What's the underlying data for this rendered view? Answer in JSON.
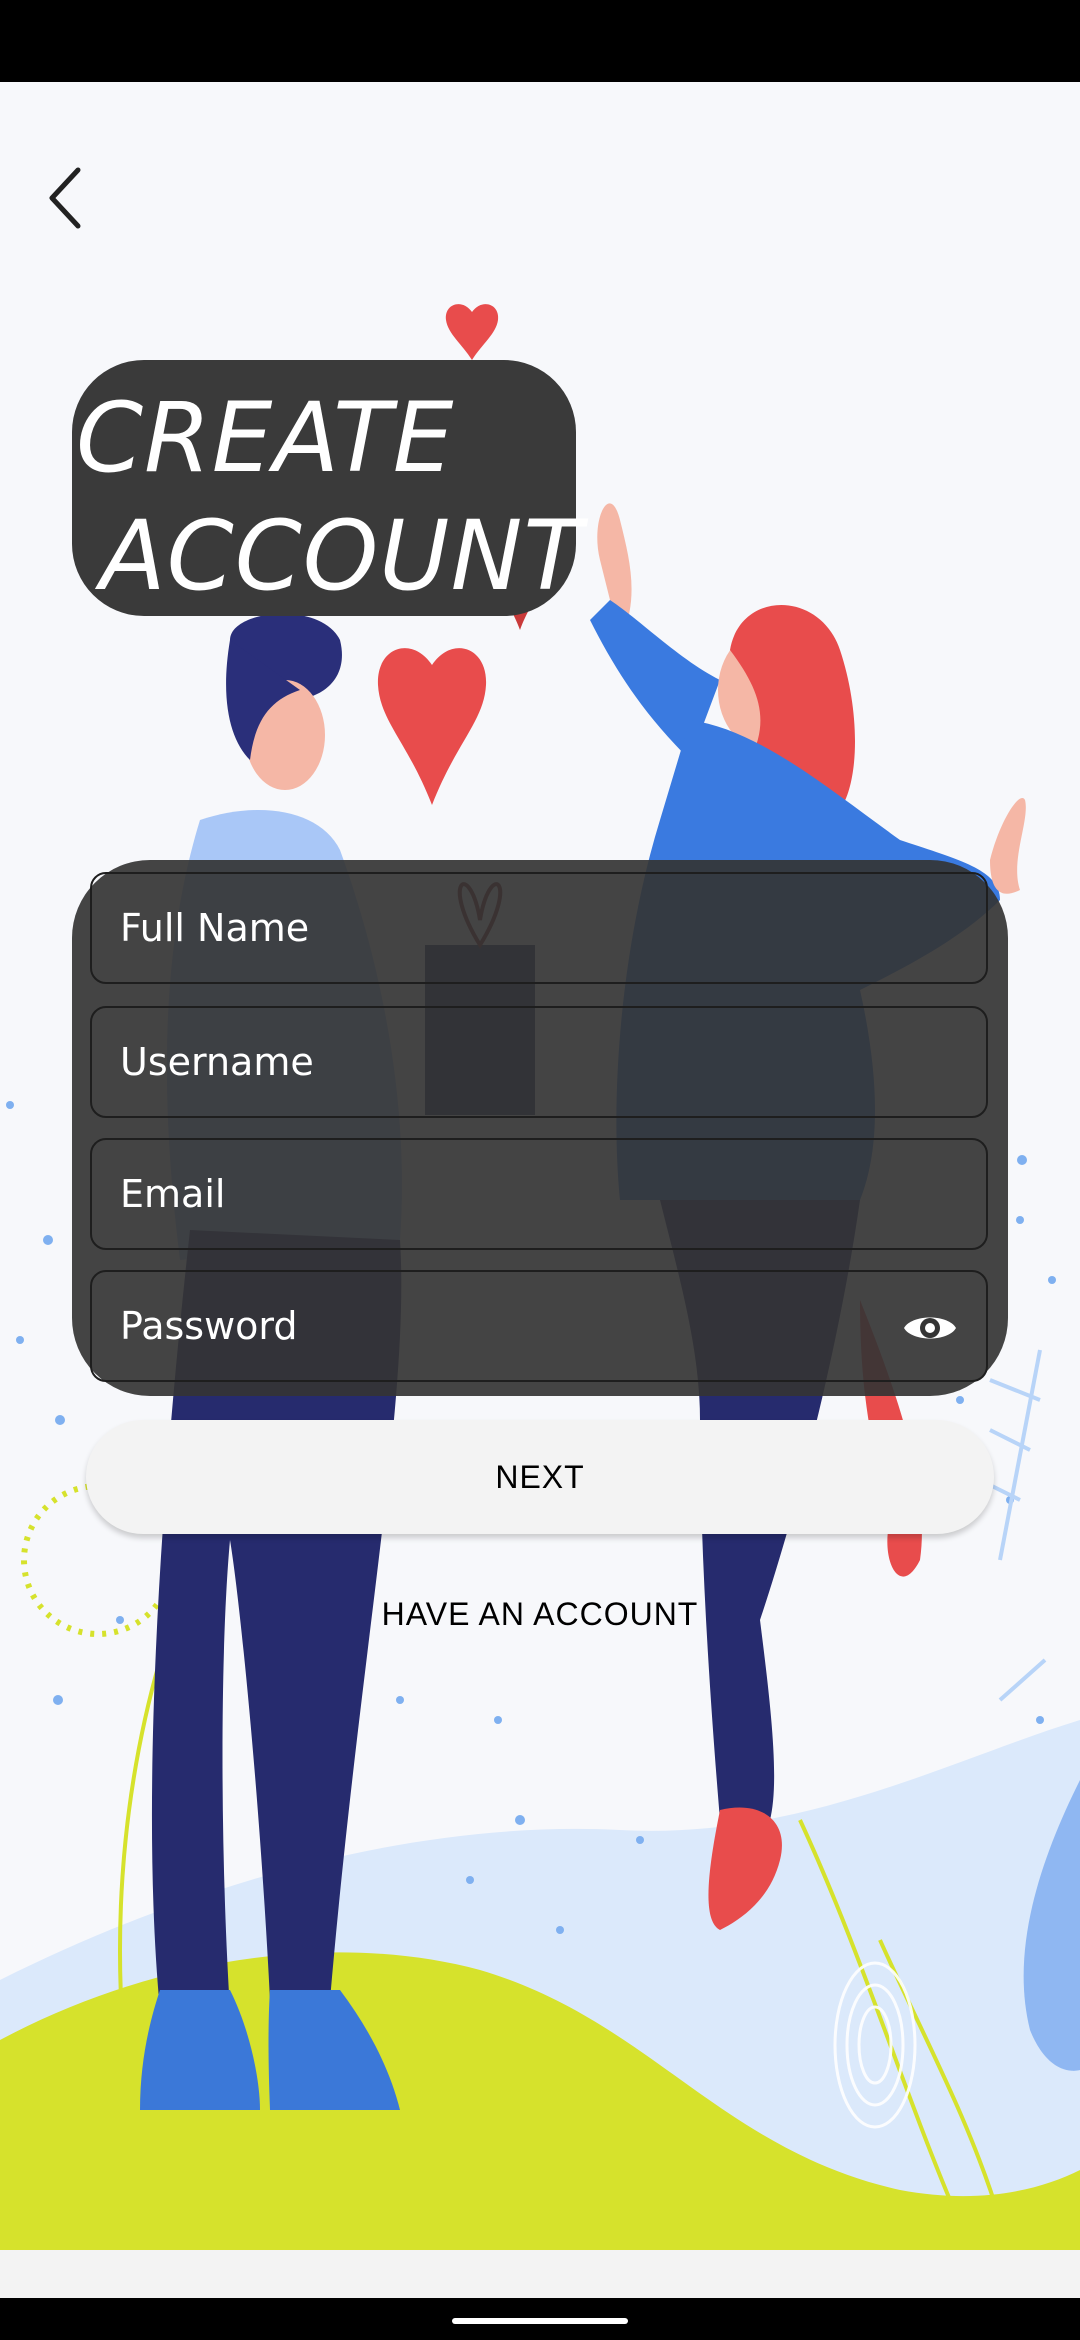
{
  "header": {
    "title_line1": "CREATE",
    "title_line2": "ACCOUNT"
  },
  "form": {
    "full_name_placeholder": "Full Name",
    "username_placeholder": "Username",
    "email_placeholder": "Email",
    "password_placeholder": "Password"
  },
  "actions": {
    "next_label": "NEXT",
    "have_account_label": "HAVE AN ACCOUNT"
  },
  "icons": {
    "back": "back-arrow-icon",
    "password_toggle": "eye-icon"
  },
  "colors": {
    "card": "#343434",
    "button_bg": "#f3f3f3",
    "heart": "#e84c4c",
    "ground": "#d6e22c",
    "sky_accent": "#dbe9fb"
  }
}
